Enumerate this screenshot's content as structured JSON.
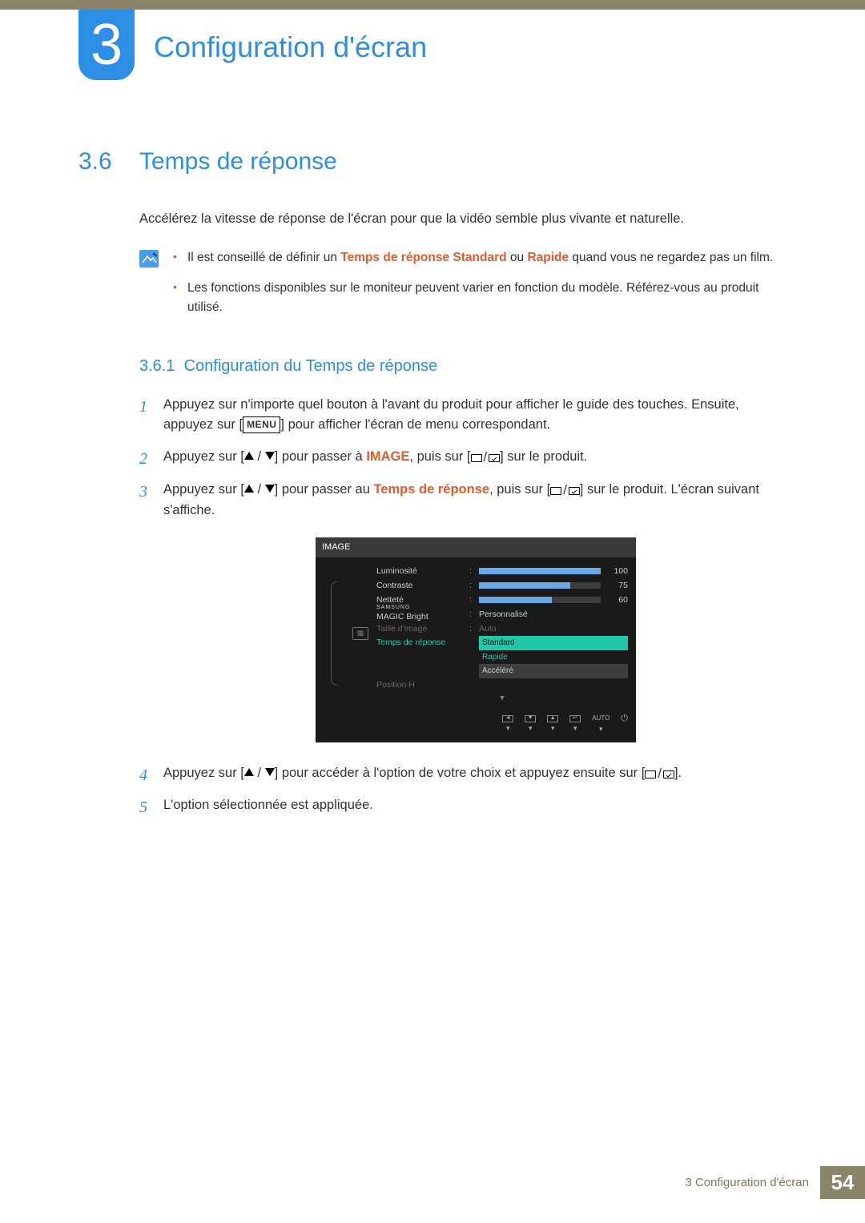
{
  "chapter": {
    "number": "3",
    "title": "Configuration d'écran"
  },
  "section": {
    "number": "3.6",
    "title": "Temps de réponse"
  },
  "intro": "Accélérez la vitesse de réponse de l'écran pour que la vidéo semble plus vivante et naturelle.",
  "notes": {
    "n1_pre": "Il est conseillé de définir un ",
    "n1_hl1": "Temps de réponse Standard",
    "n1_mid": " ou ",
    "n1_hl2": "Rapide",
    "n1_post": " quand vous ne regardez pas un film.",
    "n2": "Les fonctions disponibles sur le moniteur peuvent varier en fonction du modèle. Référez-vous au produit utilisé."
  },
  "subsection": {
    "number": "3.6.1",
    "title": "Configuration du Temps de réponse"
  },
  "steps": {
    "s1a": "Appuyez sur n'importe quel bouton à l'avant du produit pour afficher le guide des touches. Ensuite, appuyez sur [",
    "s1b": "] pour afficher l'écran de menu correspondant.",
    "menu_key": "MENU",
    "s2a": "Appuyez sur [",
    "s2b": "] pour passer à ",
    "s2_hl": "IMAGE",
    "s2c": ", puis sur [",
    "s2d": "] sur le produit.",
    "s3a": "Appuyez sur [",
    "s3b": "] pour passer au ",
    "s3_hl": "Temps de réponse",
    "s3c": ", puis sur [",
    "s3d": "] sur le produit. L'écran suivant s'affiche.",
    "s4a": "Appuyez sur [",
    "s4b": "] pour accéder à l'option de votre choix et appuyez ensuite sur [",
    "s4c": "].",
    "s5": "L'option sélectionnée est appliquée."
  },
  "osd": {
    "header": "IMAGE",
    "rows": {
      "luminosite": {
        "label": "Luminosité",
        "value": "100",
        "fill": 100
      },
      "contraste": {
        "label": "Contraste",
        "value": "75",
        "fill": 75
      },
      "nettete": {
        "label": "Netteté",
        "value": "60",
        "fill": 60
      },
      "magic_top": "SAMSUNG",
      "magic": "MAGIC",
      "magic_suffix": " Bright",
      "magic_val": "Personnalisé",
      "taille": {
        "label": "Taille d'image",
        "value": "Auto"
      },
      "temps": "Temps de réponse",
      "opts": {
        "standard": "Standard",
        "rapide": "Rapide",
        "accelere": "Accéléré"
      },
      "posh": "Position H"
    },
    "footer": {
      "auto": "AUTO"
    }
  },
  "footer": {
    "text": "3 Configuration d'écran",
    "page": "54"
  }
}
